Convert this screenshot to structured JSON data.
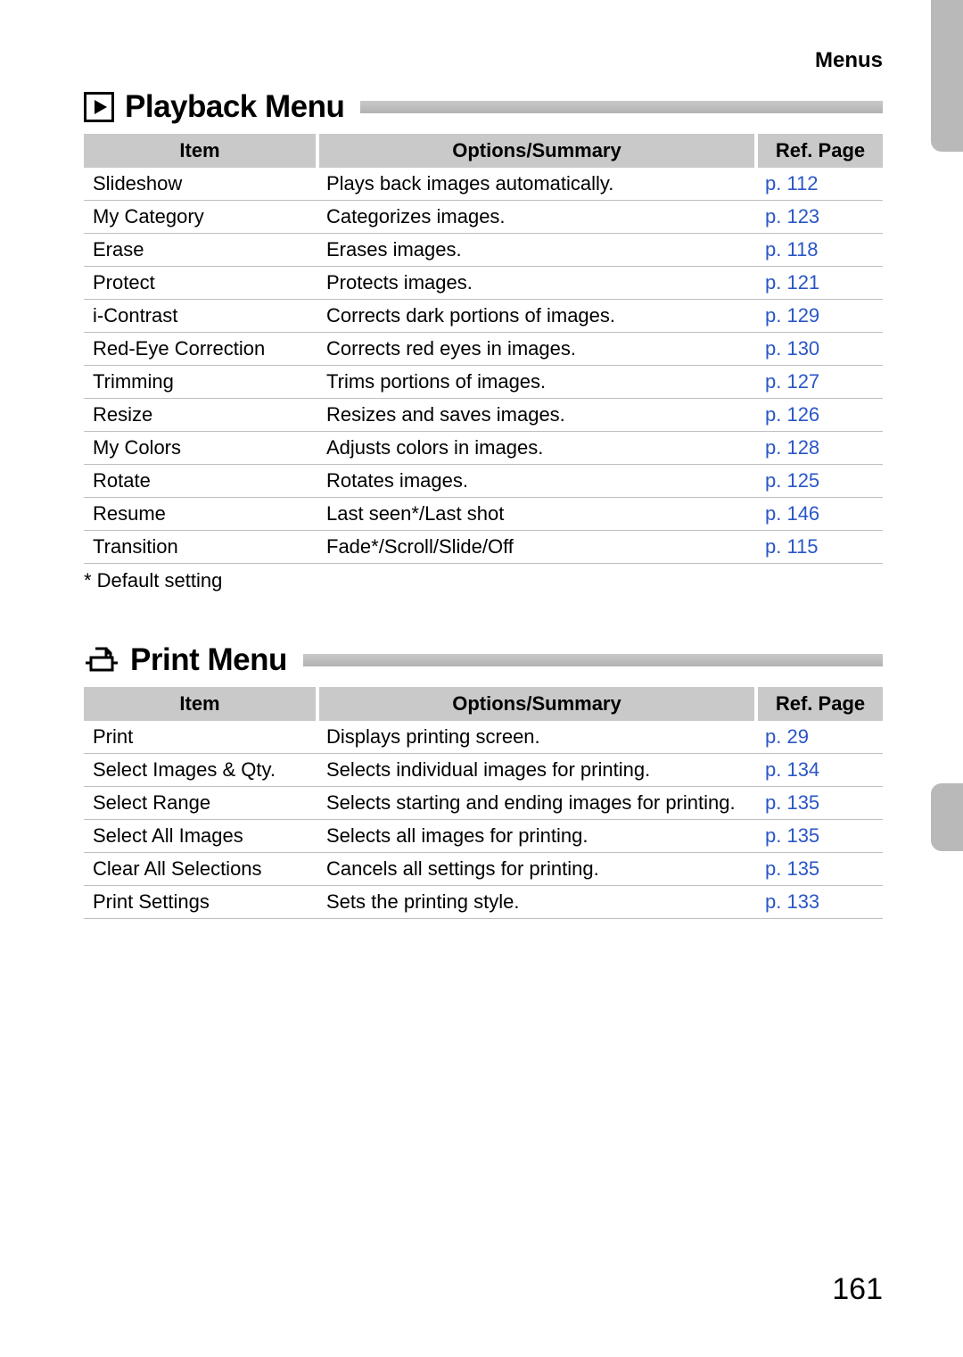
{
  "running_header": "Menus",
  "page_number": "161",
  "sections": [
    {
      "title": "Playback Menu",
      "icon": "play-icon",
      "headers": {
        "item": "Item",
        "summary": "Options/Summary",
        "ref": "Ref. Page"
      },
      "rows": [
        {
          "item": "Slideshow",
          "summary": "Plays back images automatically.",
          "ref": "p. 112"
        },
        {
          "item": "My Category",
          "summary": "Categorizes images.",
          "ref": "p. 123"
        },
        {
          "item": "Erase",
          "summary": "Erases images.",
          "ref": "p. 118"
        },
        {
          "item": "Protect",
          "summary": "Protects images.",
          "ref": "p. 121"
        },
        {
          "item": "i-Contrast",
          "summary": "Corrects dark portions of images.",
          "ref": "p. 129"
        },
        {
          "item": "Red-Eye Correction",
          "summary": "Corrects red eyes in images.",
          "ref": "p. 130"
        },
        {
          "item": "Trimming",
          "summary": "Trims portions of images.",
          "ref": "p. 127"
        },
        {
          "item": "Resize",
          "summary": "Resizes and saves images.",
          "ref": "p. 126"
        },
        {
          "item": "My Colors",
          "summary": "Adjusts colors in images.",
          "ref": "p. 128"
        },
        {
          "item": "Rotate",
          "summary": "Rotates images.",
          "ref": "p. 125"
        },
        {
          "item": "Resume",
          "summary": "Last seen*/Last shot",
          "ref": "p. 146"
        },
        {
          "item": "Transition",
          "summary": "Fade*/Scroll/Slide/Off",
          "ref": "p. 115"
        }
      ],
      "footnote": "* Default setting"
    },
    {
      "title": "Print Menu",
      "icon": "print-icon",
      "headers": {
        "item": "Item",
        "summary": "Options/Summary",
        "ref": "Ref. Page"
      },
      "rows": [
        {
          "item": "Print",
          "summary": "Displays printing screen.",
          "ref": "p. 29"
        },
        {
          "item": "Select Images & Qty.",
          "summary": "Selects individual images for printing.",
          "ref": "p. 134"
        },
        {
          "item": "Select Range",
          "summary": "Selects starting and ending images for printing.",
          "ref": "p. 135"
        },
        {
          "item": "Select All Images",
          "summary": "Selects all images for printing.",
          "ref": "p. 135"
        },
        {
          "item": "Clear All Selections",
          "summary": "Cancels all settings for printing.",
          "ref": "p. 135"
        },
        {
          "item": "Print Settings",
          "summary": "Sets the printing style.",
          "ref": "p. 133"
        }
      ],
      "footnote": ""
    }
  ]
}
